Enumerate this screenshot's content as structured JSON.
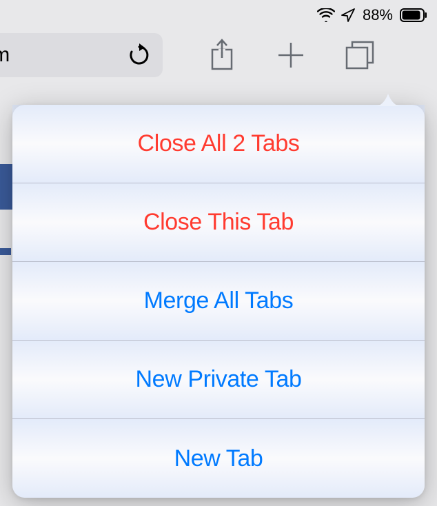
{
  "status": {
    "battery_pct": "88%"
  },
  "toolbar": {
    "url_fragment": "com"
  },
  "popover": {
    "items": [
      {
        "label": "Close All 2 Tabs",
        "style": "destructive"
      },
      {
        "label": "Close This Tab",
        "style": "destructive"
      },
      {
        "label": "Merge All Tabs",
        "style": "normal"
      },
      {
        "label": "New Private Tab",
        "style": "normal"
      },
      {
        "label": "New Tab",
        "style": "normal"
      }
    ]
  }
}
